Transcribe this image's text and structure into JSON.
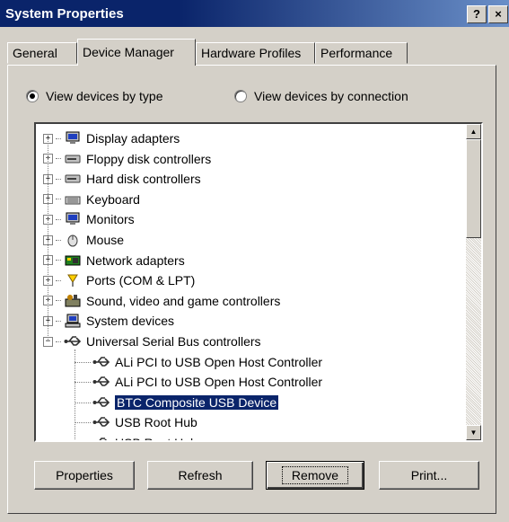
{
  "window": {
    "title": "System Properties",
    "help_label": "?",
    "close_label": "×"
  },
  "tabs": [
    {
      "label": "General"
    },
    {
      "label": "Device Manager"
    },
    {
      "label": "Hardware Profiles"
    },
    {
      "label": "Performance"
    }
  ],
  "view": {
    "by_type_label": "View devices by type",
    "by_connection_label": "View devices by connection",
    "selected": "by_type"
  },
  "tree": [
    {
      "label": "Display adapters",
      "icon": "monitor-icon",
      "level": 0,
      "expander": "+"
    },
    {
      "label": "Floppy disk controllers",
      "icon": "disk-drive-icon",
      "level": 0,
      "expander": "+"
    },
    {
      "label": "Hard disk controllers",
      "icon": "disk-drive-icon",
      "level": 0,
      "expander": "+"
    },
    {
      "label": "Keyboard",
      "icon": "keyboard-icon",
      "level": 0,
      "expander": "+"
    },
    {
      "label": "Monitors",
      "icon": "monitor-icon",
      "level": 0,
      "expander": "+"
    },
    {
      "label": "Mouse",
      "icon": "mouse-icon",
      "level": 0,
      "expander": "+"
    },
    {
      "label": "Network adapters",
      "icon": "network-card-icon",
      "level": 0,
      "expander": "+"
    },
    {
      "label": "Ports (COM & LPT)",
      "icon": "port-icon",
      "level": 0,
      "expander": "+"
    },
    {
      "label": "Sound, video and game controllers",
      "icon": "sound-icon",
      "level": 0,
      "expander": "+"
    },
    {
      "label": "System devices",
      "icon": "computer-icon",
      "level": 0,
      "expander": "+"
    },
    {
      "label": "Universal Serial Bus controllers",
      "icon": "usb-icon",
      "level": 0,
      "expander": "−"
    },
    {
      "label": "ALi PCI to USB Open Host Controller",
      "icon": "usb-icon",
      "level": 1
    },
    {
      "label": "ALi PCI to USB Open Host Controller",
      "icon": "usb-icon",
      "level": 1
    },
    {
      "label": "BTC Composite USB Device",
      "icon": "usb-icon",
      "level": 1,
      "selected": true
    },
    {
      "label": "USB Root Hub",
      "icon": "usb-icon",
      "level": 1
    },
    {
      "label": "USB Root Hub",
      "icon": "usb-icon",
      "level": 1
    }
  ],
  "buttons": {
    "properties": "Properties",
    "refresh": "Refresh",
    "remove": "Remove",
    "print": "Print..."
  },
  "colors": {
    "title_bar": "#0a246a",
    "face": "#d4d0c8",
    "selection": "#0a246a"
  }
}
